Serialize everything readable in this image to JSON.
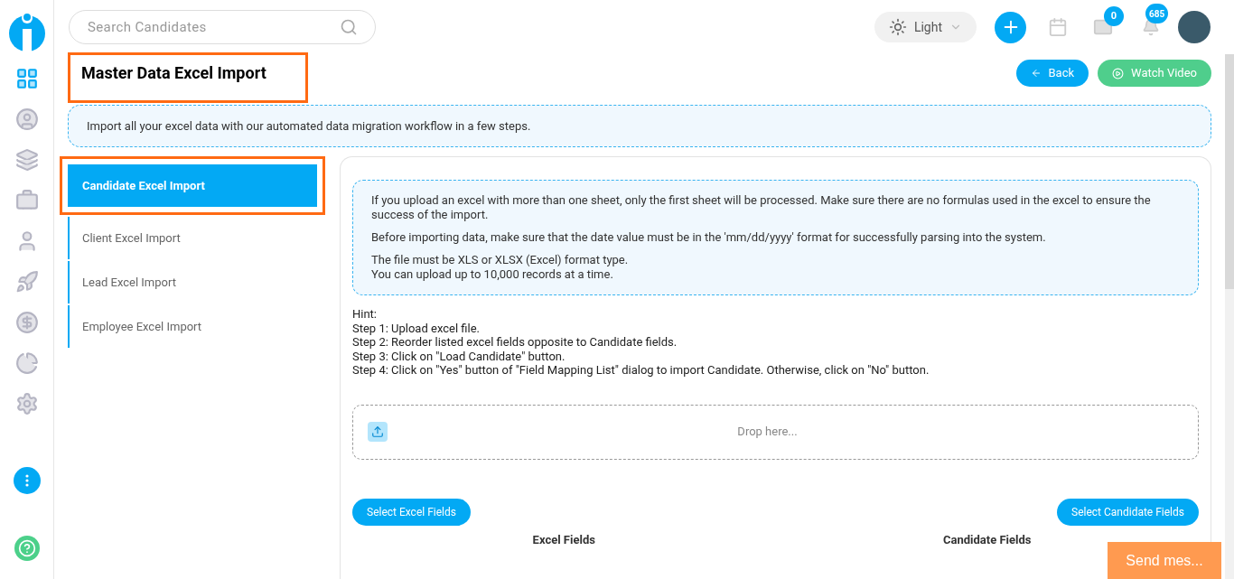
{
  "sidebar": {
    "items": [
      {
        "kind": "dashboard",
        "selected": true
      },
      {
        "kind": "user",
        "selected": false
      },
      {
        "kind": "layers",
        "selected": false
      },
      {
        "kind": "briefcase",
        "selected": false
      },
      {
        "kind": "person",
        "selected": false
      },
      {
        "kind": "rocket",
        "selected": false
      },
      {
        "kind": "dollar",
        "selected": false
      },
      {
        "kind": "pie",
        "selected": false
      },
      {
        "kind": "gear",
        "selected": false
      }
    ]
  },
  "search": {
    "placeholder": "Search Candidates"
  },
  "theme": {
    "label": "Light"
  },
  "mail_badge": "0",
  "notification_badge": "685",
  "page_title": "Master Data Excel Import",
  "buttons": {
    "back": "Back",
    "watch_video": "Watch Video"
  },
  "intro": "Import all your excel data with our automated data migration workflow in a few steps.",
  "tabs": [
    {
      "label": "Candidate Excel Import",
      "selected": true
    },
    {
      "label": "Client Excel Import",
      "selected": false
    },
    {
      "label": "Lead Excel Import",
      "selected": false
    },
    {
      "label": "Employee Excel Import",
      "selected": false
    }
  ],
  "notes": [
    "If you upload an excel with more than one sheet, only the first sheet will be processed. Make sure there are no formulas used in the excel to ensure the success of the import.",
    "Before importing data, make sure that the date value must be in the 'mm/dd/yyyy' format for successfully parsing into the system.",
    "The file must be XLS or XLSX (Excel) format type.",
    "You can upload up to 10,000 records at a time."
  ],
  "hint": [
    "Hint:",
    "Step 1: Upload excel file.",
    "Step 2: Reorder listed excel fields opposite to Candidate fields.",
    "Step 3: Click on \"Load Candidate\" button.",
    "Step 4: Click on \"Yes\" button of \"Field Mapping List\" dialog to import Candidate. Otherwise, click on \"No\" button."
  ],
  "dropzone": {
    "text": "Drop here..."
  },
  "select_buttons": [
    "Select Excel Fields",
    "Select Candidate Fields"
  ],
  "columns": [
    "Excel Fields",
    "Candidate Fields"
  ],
  "chat": {
    "label": "Send mes..."
  }
}
